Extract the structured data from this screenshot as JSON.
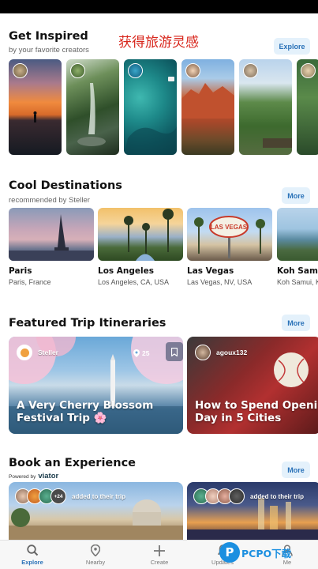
{
  "promo_banner": "获得旅游灵感",
  "inspired": {
    "title": "Get Inspired",
    "subtitle": "by your favorite creators",
    "button": "Explore"
  },
  "destinations": {
    "title": "Cool Destinations",
    "subtitle": "recommended by Steller",
    "button": "More",
    "items": [
      {
        "name": "Paris",
        "location": "Paris, France"
      },
      {
        "name": "Los Angeles",
        "location": "Los Angeles, CA, USA"
      },
      {
        "name": "Las Vegas",
        "location": "Las Vegas, NV, USA"
      },
      {
        "name": "Koh Sam",
        "location": "Koh Samui, K"
      }
    ],
    "sign_text": "LAS VEGAS"
  },
  "itineraries": {
    "title": "Featured Trip Itineraries",
    "button": "More",
    "items": [
      {
        "owner": "Steller",
        "pin_count": "25",
        "title_line1": "A Very Cherry Blossom",
        "title_line2": "Festival Trip 🌸"
      },
      {
        "owner": "agoux132",
        "title_line1": "How to Spend Openi",
        "title_line2": "Day in 5 Cities"
      }
    ]
  },
  "experience": {
    "title": "Book an Experience",
    "powered_by": "Powered by",
    "partner": "viator",
    "items": [
      {
        "extra_count": "+24",
        "text": "added to their trip"
      },
      {
        "text": "added to their trip"
      }
    ]
  },
  "nav": {
    "items": [
      {
        "label": "Explore",
        "icon": "search-icon"
      },
      {
        "label": "Nearby",
        "icon": "map-pin-icon"
      },
      {
        "label": "Create",
        "icon": "plus-icon"
      },
      {
        "label": "Updates",
        "icon": "bell-icon"
      },
      {
        "label": "Me",
        "icon": "person-icon"
      }
    ]
  },
  "watermark": {
    "letter": "P",
    "brand": "PCPO下载"
  },
  "colors": {
    "accent": "#2a72b8",
    "promo": "#d8261c",
    "pill_bg": "#e4f1fb"
  }
}
